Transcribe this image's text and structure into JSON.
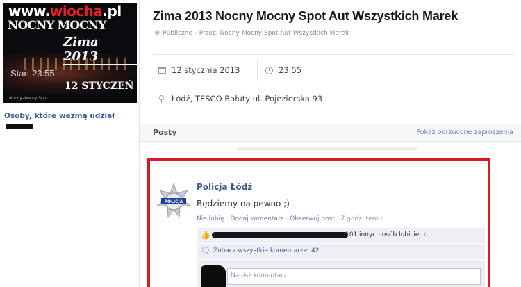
{
  "watermark": {
    "text_main": "www.",
    "text_red": "wiocha",
    "text_tail": ".pl"
  },
  "cover": {
    "line1": "NOCNY MOCNY",
    "line2": "Zima 2013",
    "start": "Start 23:55",
    "date": "12 STYCZEŃ",
    "tiny": "Nocny-Mocny Spot"
  },
  "sidebar": {
    "attending_label": "Osoby, które wezmą udział"
  },
  "event": {
    "title": "Zima 2013 Nocny Mocny Spot Aut Wszystkich Marek",
    "meta_visibility": "Publiczne",
    "meta_by": "· Przez: Nocny-Mocny Spot Aut Wszystkich Marek",
    "date": "12 stycznia 2013",
    "time": "23:55",
    "location": "Łódź, TESCO Bałuty ul. Pojezierska 93"
  },
  "posts": {
    "label": "Posty",
    "rejected_link": "Pokaż odrzucone zaproszenia"
  },
  "post": {
    "badge_text": "POLICJA",
    "author": "Policja Łódź",
    "text": "Będziemy na pewno ;)",
    "action_unlike": "Nie lubię",
    "action_comment": "Dodaj komentarz",
    "action_follow": "Obserwuj post",
    "time": "7 godz. temu",
    "likes_text": "101 innych osób lubicie to.",
    "comments_text": "Zobacz wszystkie komentarze: 42",
    "write_placeholder": "Napisz komentarz..."
  },
  "colors": {
    "highlight": "#d61a22",
    "link": "#3b5998"
  }
}
